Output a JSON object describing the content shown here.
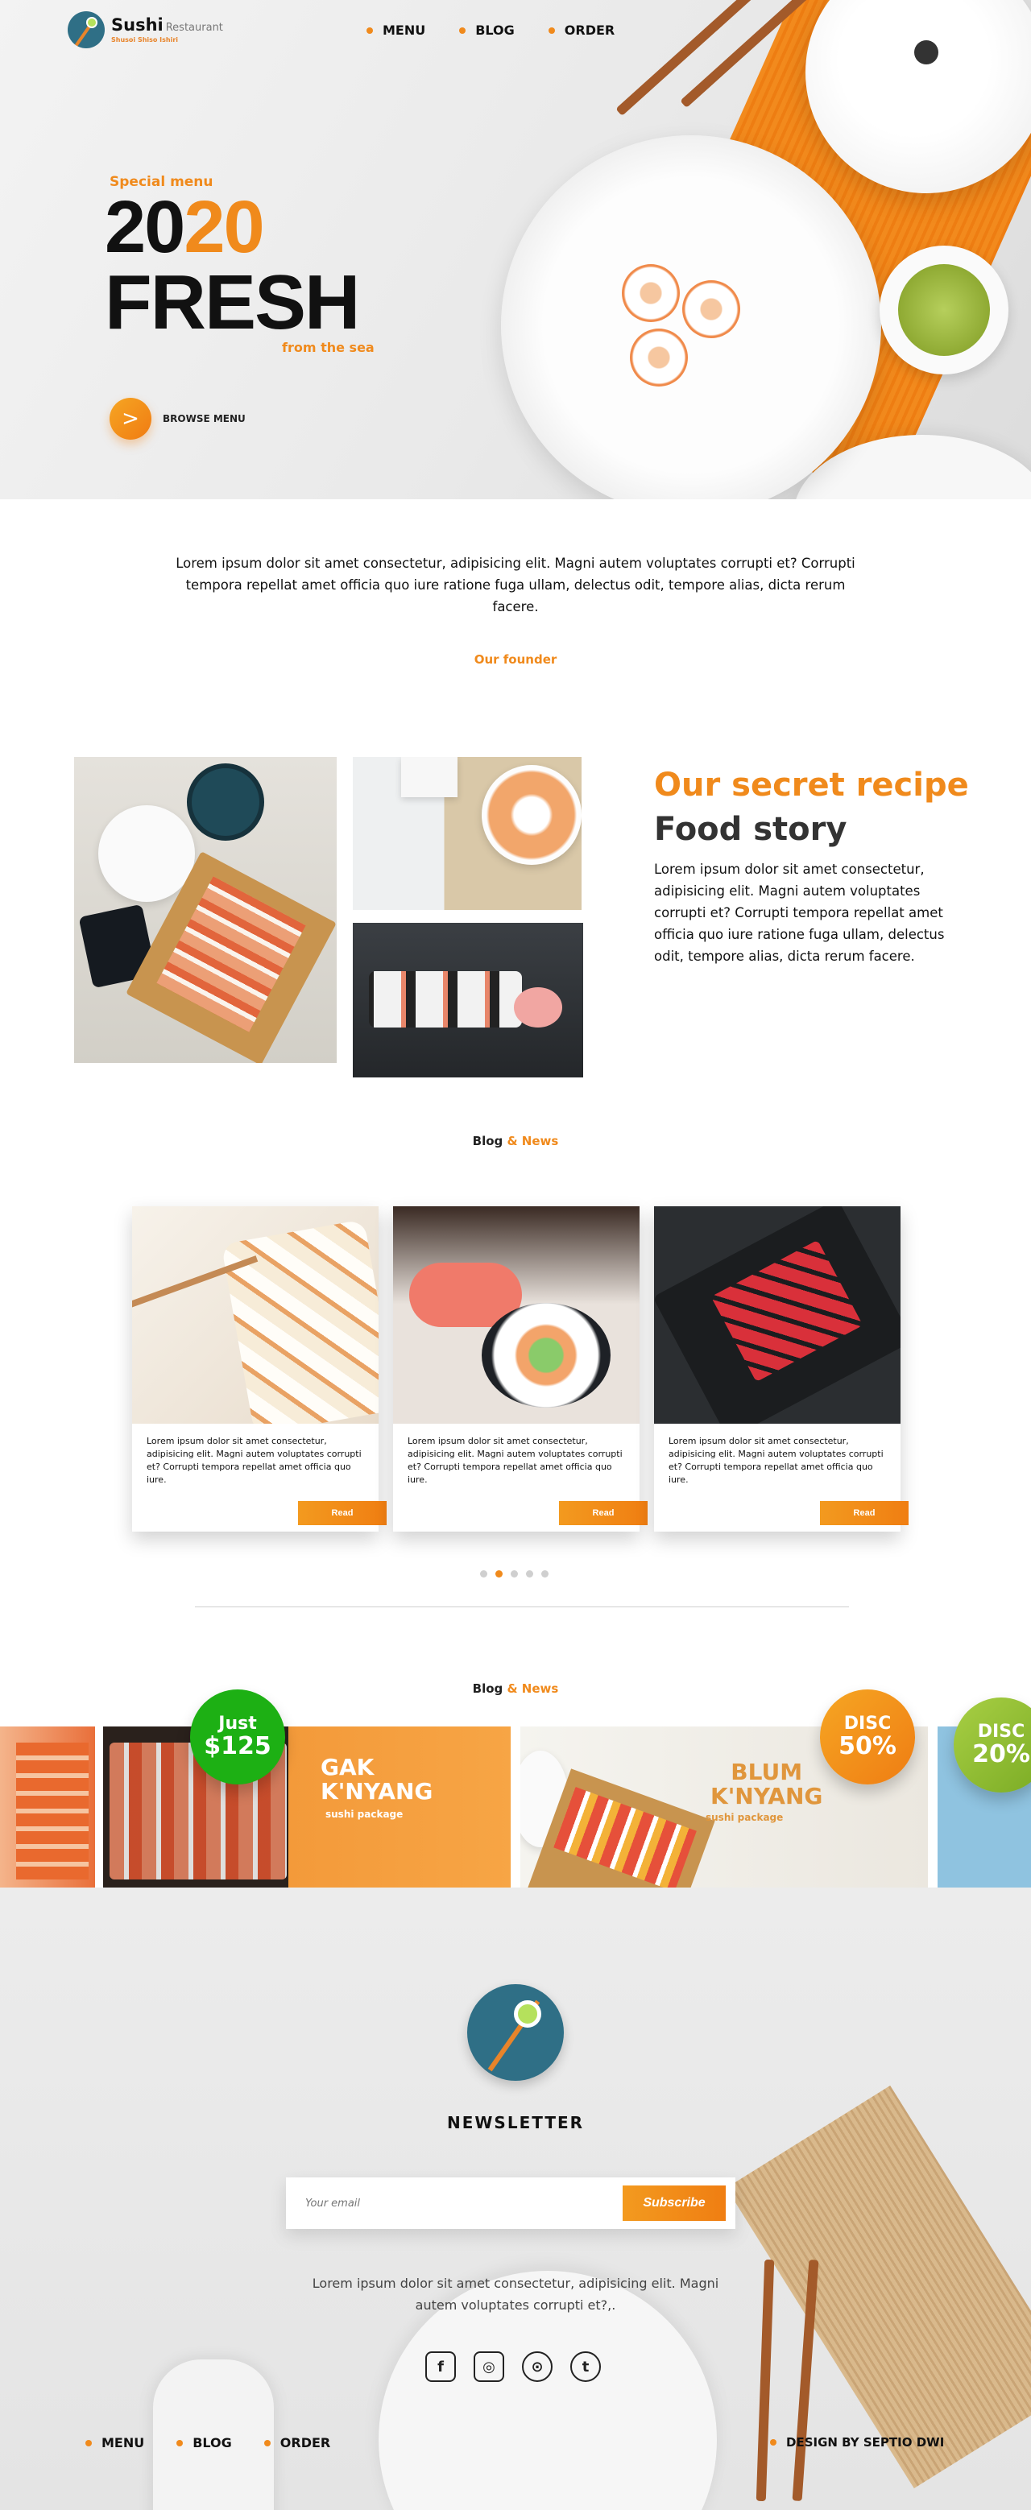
{
  "brand": {
    "name": "Sushi",
    "sub": "Restaurant",
    "tagline": "Shusoi Shiso Ishiri"
  },
  "nav": [
    "MENU",
    "BLOG",
    "ORDER"
  ],
  "hero": {
    "special": "Special menu",
    "year_a": "20",
    "year_b": "20",
    "headline": "FRESH",
    "from": "from the sea",
    "browse": "BROWSE MENU",
    "browse_icon": ">"
  },
  "intro": {
    "text": "Lorem ipsum dolor sit amet consectetur, adipisicing elit. Magni autem voluptates corrupti et? Corrupti tempora repellat amet officia quo iure ratione fuga ullam, delectus odit, tempore alias, dicta rerum facere.",
    "founder": "Our founder"
  },
  "story": {
    "title_orange": "Our secret recipe",
    "title_dark": "Food story",
    "text": "Lorem ipsum dolor sit amet consectetur, adipisicing elit. Magni autem voluptates corrupti et? Corrupti tempora repellat amet officia quo iure ratione fuga ullam, delectus odit, tempore alias, dicta rerum facere."
  },
  "blog": {
    "title_a": "Blog",
    "title_b": " & News",
    "cards": [
      {
        "text": "Lorem ipsum dolor sit amet consectetur, adipisicing elit. Magni autem voluptates corrupti et? Corrupti tempora repellat amet officia quo iure.",
        "button": "Read"
      },
      {
        "text": "Lorem ipsum dolor sit amet consectetur, adipisicing elit. Magni autem voluptates corrupti et? Corrupti tempora repellat amet officia quo iure.",
        "button": "Read"
      },
      {
        "text": "Lorem ipsum dolor sit amet consectetur, adipisicing elit. Magni autem voluptates corrupti et? Corrupti tempora repellat amet officia quo iure.",
        "button": "Read"
      }
    ],
    "pagination_active": 2
  },
  "promo": {
    "title_a": "Blog",
    "title_b": " & News",
    "items": [
      {
        "title": "GAK\nK'NYANG",
        "sub": "sushi package",
        "badge_l1": "Just",
        "badge_l2": "$125"
      },
      {
        "title": "BLUM\nK'NYANG",
        "sub": "sushi package",
        "badge_l1": "DISC",
        "badge_l2": "50%"
      },
      {
        "badge_l1": "DISC",
        "badge_l2": "20%"
      }
    ]
  },
  "newsletter": {
    "title": "NEWSLETTER",
    "placeholder": "Your email",
    "button": "Subscribe",
    "text": "Lorem ipsum dolor sit amet consectetur, adipisicing elit. Magni autem voluptates corrupti et?,."
  },
  "social": [
    {
      "name": "facebook-icon",
      "glyph": "f"
    },
    {
      "name": "instagram-icon",
      "glyph": "◎"
    },
    {
      "name": "location-pin-icon",
      "glyph": "⊙"
    },
    {
      "name": "tumblr-icon",
      "glyph": "t"
    }
  ],
  "footer": {
    "nav": [
      "MENU",
      "BLOG",
      "ORDER"
    ],
    "design": "DESIGN BY SEPTIO DWI"
  },
  "colors": {
    "accent": "#f08a1c",
    "dark": "#111111",
    "green": "#1db014",
    "badge_orange": "#f39a1f",
    "badge_lime": "#8cbf2c"
  }
}
